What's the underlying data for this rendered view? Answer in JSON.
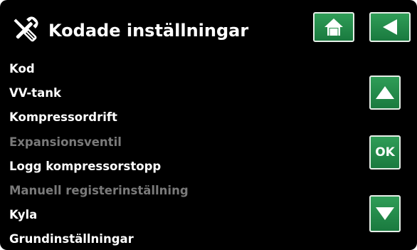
{
  "header": {
    "title": "Kodade inställningar",
    "icon": "tools-icon"
  },
  "menu": {
    "items": [
      {
        "label": "Kod",
        "enabled": true
      },
      {
        "label": "VV-tank",
        "enabled": true
      },
      {
        "label": "Kompressordrift",
        "enabled": true
      },
      {
        "label": "Expansionsventil",
        "enabled": false
      },
      {
        "label": "Logg kompressorstopp",
        "enabled": true
      },
      {
        "label": "Manuell registerinställning",
        "enabled": false
      },
      {
        "label": "Kyla",
        "enabled": true
      },
      {
        "label": "Grundinställningar",
        "enabled": true
      }
    ]
  },
  "nav": {
    "home_icon": "home-icon",
    "back_icon": "back-arrow-icon",
    "up_icon": "up-arrow-icon",
    "ok_label": "OK",
    "down_icon": "down-arrow-icon"
  },
  "colors": {
    "background": "#000000",
    "text_enabled": "#ffffff",
    "text_disabled": "#7a7a7a",
    "button_green": "#239048",
    "button_border": "#e6efe8"
  }
}
